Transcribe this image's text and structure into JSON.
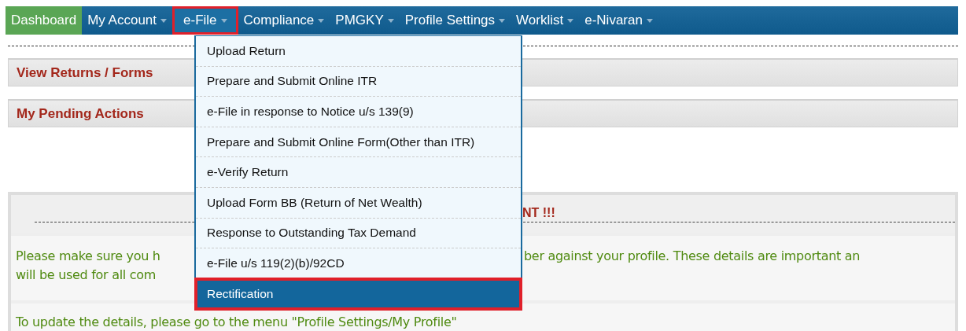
{
  "nav": [
    {
      "label": "Dashboard",
      "selected": true,
      "has_caret": false,
      "highlighted": false,
      "open": false
    },
    {
      "label": "My Account",
      "selected": false,
      "has_caret": true,
      "highlighted": false,
      "open": false
    },
    {
      "label": "e-File",
      "selected": false,
      "has_caret": true,
      "highlighted": true,
      "open": true
    },
    {
      "label": "Compliance",
      "selected": false,
      "has_caret": true,
      "highlighted": false,
      "open": false
    },
    {
      "label": "PMGKY",
      "selected": false,
      "has_caret": true,
      "highlighted": false,
      "open": false
    },
    {
      "label": "Profile Settings",
      "selected": false,
      "has_caret": true,
      "highlighted": false,
      "open": false
    },
    {
      "label": "Worklist",
      "selected": false,
      "has_caret": true,
      "highlighted": false,
      "open": false
    },
    {
      "label": "e-Nivaran",
      "selected": false,
      "has_caret": true,
      "highlighted": false,
      "open": false
    }
  ],
  "dropdown": [
    {
      "label": "Upload Return",
      "selected": false,
      "highlighted": false
    },
    {
      "label": "Prepare and Submit Online ITR",
      "selected": false,
      "highlighted": false
    },
    {
      "label": "e-File in response to Notice u/s 139(9)",
      "selected": false,
      "highlighted": false
    },
    {
      "label": "Prepare and Submit Online Form(Other than ITR)",
      "selected": false,
      "highlighted": false
    },
    {
      "label": "e-Verify Return",
      "selected": false,
      "highlighted": false
    },
    {
      "label": "Upload Form BB (Return of Net Wealth)",
      "selected": false,
      "highlighted": false
    },
    {
      "label": "Response to Outstanding Tax Demand",
      "selected": false,
      "highlighted": false
    },
    {
      "label": "e-File u/s 119(2)(b)/92CD",
      "selected": false,
      "highlighted": false
    },
    {
      "label": "Rectification",
      "selected": true,
      "highlighted": true
    }
  ],
  "sections": [
    "View Returns / Forms",
    "My Pending Actions"
  ],
  "notice": {
    "title_visible": "NT !!!",
    "message_left": [
      "Please make sure you h",
      "will be used for all com"
    ],
    "message_right": "ber against your profile. These details are important an",
    "update_text": "To update the details, please go to the menu \"Profile Settings/My Profile\""
  }
}
